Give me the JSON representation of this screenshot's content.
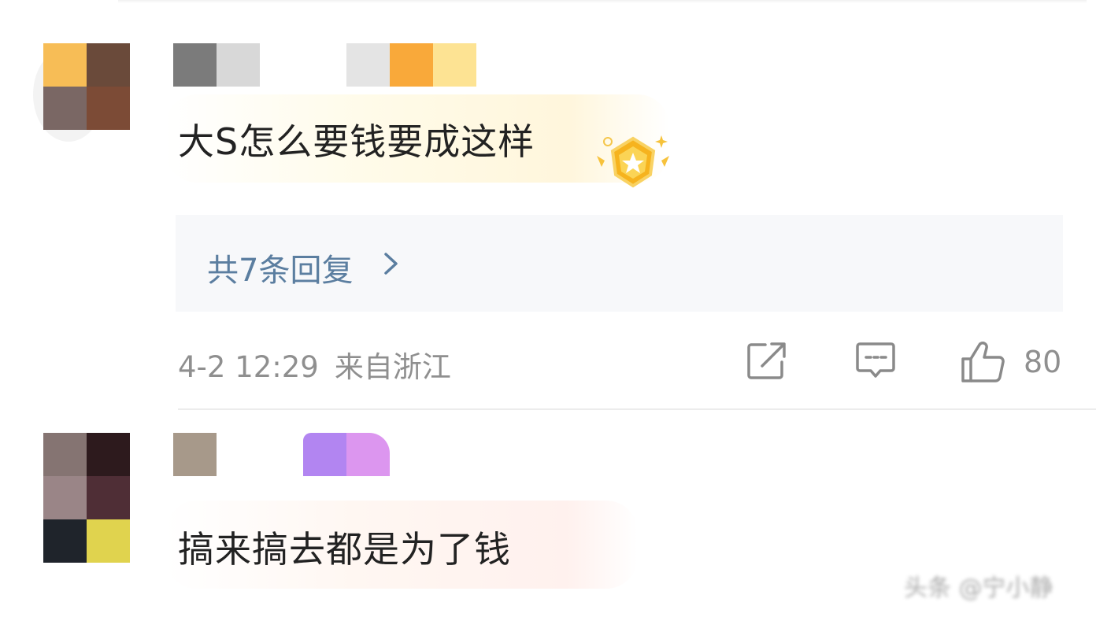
{
  "comments": [
    {
      "text": "大S怎么要钱要成这样",
      "replies_label": "共7条回复",
      "date": "4-2 12:29",
      "location": "来自浙江",
      "likes": "80",
      "avatar_pixels": [
        "#f7bd56",
        "#6a4a3a",
        "#7a6764",
        "#7c4b36"
      ],
      "name_pixels": [
        "#7b7b7b",
        "#d8d8d8",
        "#ffffff",
        "#ffffff",
        "#e4e4e4",
        "#f9a93a",
        "#fde393"
      ],
      "medal_icon": "gold-medal-icon"
    },
    {
      "text": "搞来搞去都是为了钱",
      "avatar_pixels": [
        "#857472",
        "#2d1a1d",
        "#9a8587",
        "#4f2e36",
        "#1f242b",
        "#e0d34e"
      ],
      "name_pixels": [
        "#a7998a",
        "#ffffff",
        "#ffffff",
        "#b285f1",
        "#dc96ef"
      ]
    }
  ],
  "icons": {
    "share": "share-icon",
    "comment": "comment-icon",
    "like": "thumbs-up-icon",
    "chevron": "chevron-right-icon"
  },
  "watermark": "头条 @宁小静"
}
